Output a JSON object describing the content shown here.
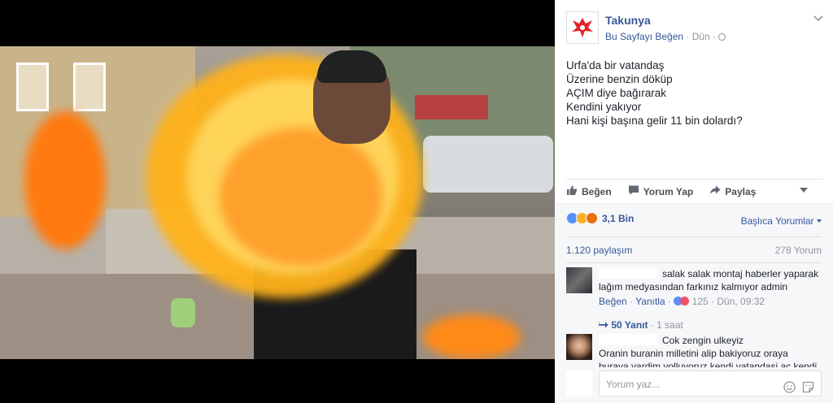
{
  "post": {
    "page_name": "Takunya",
    "like_page": "Bu Sayfayı Beğen",
    "time": "· Dün ·",
    "text_lines": [
      "Urfa'da bir vatandaş",
      "Üzerine benzin döküp",
      "AÇIM diye bağırarak",
      "Kendini yakıyor",
      "Hani kişi başına gelir 11 bin dolardı?"
    ]
  },
  "actions": {
    "like": "Beğen",
    "comment": "Yorum Yap",
    "share": "Paylaş"
  },
  "feedback": {
    "reaction_count": "3,1 Bin",
    "top_comments": "Başlıca Yorumlar",
    "shares": "1.120 paylaşım",
    "comments": "278 Yorum"
  },
  "comments": [
    {
      "line1": "salak salak montaj haberler yaparak",
      "line2": "lağım medyasından farkınız kalmıyor admin",
      "like": "Beğen",
      "reply": "Yanıtla",
      "reaction_count": "125",
      "time": "· Dün, 09:32",
      "replies_label": "50 Yanıt",
      "replies_time": "· 1 saat"
    },
    {
      "line1": "Cok zengin ulkeyiz",
      "line2": "Oranin buranin milletini alip bakiyoruz oraya",
      "line3": "buraya yardim yolluyoruz kendi vatandasi ac kendi"
    }
  ],
  "composer": {
    "placeholder": "Yorum yaz..."
  },
  "colors": {
    "link": "#365899",
    "meta": "#90949c",
    "like_blue": "#5890ff",
    "love_red": "#f25268",
    "haha_yellow": "#f7b125"
  },
  "icons": [
    "page-logo-icon",
    "chevron-down-icon",
    "globe-icon",
    "like-icon",
    "comment-icon",
    "share-icon",
    "reply-arrow-icon",
    "emoji-icon",
    "sticker-icon"
  ]
}
